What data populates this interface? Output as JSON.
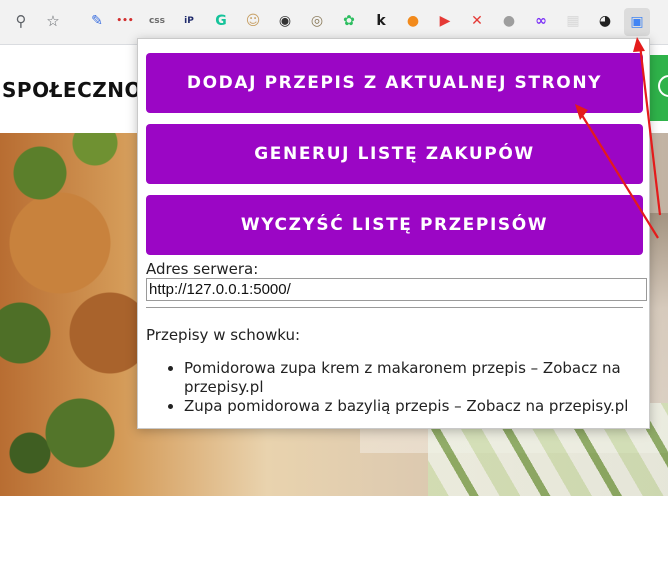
{
  "browser": {
    "icons": [
      {
        "name": "zoom-icon",
        "glyph": "⚲",
        "color": "#5f6368"
      },
      {
        "name": "bookmark-star-icon",
        "glyph": "☆",
        "color": "#5f6368"
      },
      {
        "name": "pen-extension-icon",
        "glyph": "✎",
        "color": "#3b6fe0"
      },
      {
        "name": "dots-extension-icon",
        "glyph": "•••",
        "color": "#d32f2f"
      },
      {
        "name": "css-extension-icon",
        "glyph": "css",
        "color": "#6b6b6b"
      },
      {
        "name": "ip-extension-icon",
        "glyph": "iP",
        "color": "#1f2a6b"
      },
      {
        "name": "grammarly-extension-icon",
        "glyph": "G",
        "color": "#15c39a"
      },
      {
        "name": "face-extension-icon",
        "glyph": "☺",
        "color": "#c9a36a"
      },
      {
        "name": "target-extension-icon",
        "glyph": "◉",
        "color": "#333333"
      },
      {
        "name": "owl-extension-icon",
        "glyph": "◎",
        "color": "#8a7a5a"
      },
      {
        "name": "evernote-extension-icon",
        "glyph": "✿",
        "color": "#2dbe60"
      },
      {
        "name": "k-extension-icon",
        "glyph": "k",
        "color": "#1c1c1c"
      },
      {
        "name": "orange-extension-icon",
        "glyph": "●",
        "color": "#f28a1c"
      },
      {
        "name": "play-extension-icon",
        "glyph": "▶",
        "color": "#e53935"
      },
      {
        "name": "x-extension-icon",
        "glyph": "✕",
        "color": "#e53935"
      },
      {
        "name": "gray-dot-extension-icon",
        "glyph": "●",
        "color": "#9e9e9e"
      },
      {
        "name": "link-extension-icon",
        "glyph": "∞",
        "color": "#7b2ff7"
      },
      {
        "name": "grid-extension-icon",
        "glyph": "▦",
        "color": "#d8d8d8"
      },
      {
        "name": "github-extension-icon",
        "glyph": "◕",
        "color": "#222222"
      },
      {
        "name": "recipe-extension-icon",
        "glyph": "▣",
        "color": "#4285f4"
      }
    ]
  },
  "page": {
    "site_label": "SPOŁECZNO"
  },
  "popup": {
    "add_recipe_label": "DODAJ PRZEPIS Z AKTUALNEJ STRONY",
    "generate_list_label": "GENERUJ LISTĘ ZAKUPÓW",
    "clear_list_label": "WYCZYŚĆ LISTĘ PRZEPISÓW",
    "server_label": "Adres serwera:",
    "server_value": "http://127.0.0.1:5000/",
    "clipboard_label": "Przepisy w schowku:",
    "recipes": [
      "Pomidorowa zupa krem z makaronem przepis – Zobacz na przepisy.pl",
      "Zupa pomidorowa z bazylią przepis – Zobacz na przepisy.pl"
    ],
    "accent_color": "#9b06c5"
  },
  "annotation": {
    "arrow_color": "#e41b1b"
  }
}
